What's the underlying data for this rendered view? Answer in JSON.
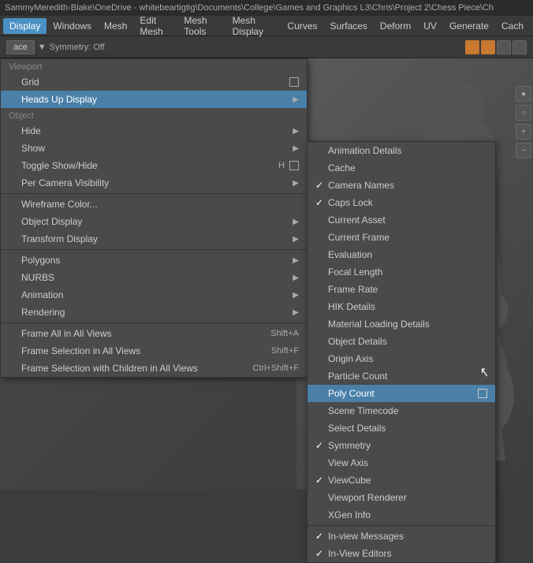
{
  "titleBar": {
    "text": "SammyMeredith-Blake\\OneDrive - whitebeartigtig\\Documents\\College\\Games and Graphics L3\\Chris\\Project 2\\Chess Piece\\Ch"
  },
  "menuBar": {
    "items": [
      {
        "label": "Display",
        "active": true
      },
      {
        "label": "Windows"
      },
      {
        "label": "Mesh"
      },
      {
        "label": "Edit Mesh"
      },
      {
        "label": "Mesh Tools"
      },
      {
        "label": "Mesh Display"
      },
      {
        "label": "Curves"
      },
      {
        "label": "Surfaces"
      },
      {
        "label": "Deform"
      },
      {
        "label": "UV"
      },
      {
        "label": "Generate"
      },
      {
        "label": "Cach"
      }
    ]
  },
  "toolbar": {
    "faceLabel": "ace",
    "symmetryLabel": "Symmetry: Off"
  },
  "primaryMenu": {
    "title": "Display",
    "sections": [
      {
        "label": "Viewport",
        "items": [
          {
            "label": "Grid",
            "check": false,
            "hasArrow": false,
            "hasBox": true,
            "shortcut": "",
            "highlighted": false
          },
          {
            "label": "Heads Up Display",
            "check": false,
            "hasArrow": true,
            "hasBox": false,
            "shortcut": "",
            "highlighted": true
          }
        ]
      },
      {
        "label": "Object",
        "items": [
          {
            "label": "Hide",
            "check": false,
            "hasArrow": true,
            "hasBox": false,
            "shortcut": "",
            "highlighted": false
          },
          {
            "label": "Show",
            "check": false,
            "hasArrow": true,
            "hasBox": false,
            "shortcut": "",
            "highlighted": false
          },
          {
            "label": "Toggle Show/Hide",
            "check": false,
            "hasArrow": false,
            "hasBox": true,
            "shortcut": "H",
            "highlighted": false
          },
          {
            "label": "Per Camera Visibility",
            "check": false,
            "hasArrow": true,
            "hasBox": false,
            "shortcut": "",
            "highlighted": false
          }
        ]
      },
      {
        "label": "",
        "items": [
          {
            "label": "Wireframe Color...",
            "check": false,
            "hasArrow": false,
            "hasBox": false,
            "shortcut": "",
            "highlighted": false
          },
          {
            "label": "Object Display",
            "check": false,
            "hasArrow": true,
            "hasBox": false,
            "shortcut": "",
            "highlighted": false
          },
          {
            "label": "Transform Display",
            "check": false,
            "hasArrow": true,
            "hasBox": false,
            "shortcut": "",
            "highlighted": false
          }
        ]
      },
      {
        "label": "",
        "items": [
          {
            "label": "Polygons",
            "check": false,
            "hasArrow": true,
            "hasBox": false,
            "shortcut": "",
            "highlighted": false
          },
          {
            "label": "NURBS",
            "check": false,
            "hasArrow": true,
            "hasBox": false,
            "shortcut": "",
            "highlighted": false
          },
          {
            "label": "Animation",
            "check": false,
            "hasArrow": true,
            "hasBox": false,
            "shortcut": "",
            "highlighted": false
          },
          {
            "label": "Rendering",
            "check": false,
            "hasArrow": true,
            "hasBox": false,
            "shortcut": "",
            "highlighted": false
          }
        ]
      },
      {
        "label": "",
        "items": [
          {
            "label": "Frame All in All Views",
            "check": false,
            "hasArrow": false,
            "hasBox": false,
            "shortcut": "Shift+A",
            "highlighted": false
          },
          {
            "label": "Frame Selection in All Views",
            "check": false,
            "hasArrow": false,
            "hasBox": false,
            "shortcut": "Shift+F",
            "highlighted": false
          },
          {
            "label": "Frame Selection with Children in All Views",
            "check": false,
            "hasArrow": false,
            "hasBox": false,
            "shortcut": "Ctrl+Shift+F",
            "highlighted": false
          }
        ]
      }
    ]
  },
  "secondaryMenu": {
    "items": [
      {
        "label": "Animation Details",
        "check": false,
        "highlighted": false
      },
      {
        "label": "Cache",
        "check": false,
        "highlighted": false
      },
      {
        "label": "Camera Names",
        "check": true,
        "highlighted": false
      },
      {
        "label": "Caps Lock",
        "check": true,
        "highlighted": false
      },
      {
        "label": "Current Asset",
        "check": false,
        "highlighted": false
      },
      {
        "label": "Current Frame",
        "check": false,
        "highlighted": false
      },
      {
        "label": "Evaluation",
        "check": false,
        "highlighted": false
      },
      {
        "label": "Focal Length",
        "check": false,
        "highlighted": false
      },
      {
        "label": "Frame Rate",
        "check": false,
        "highlighted": false
      },
      {
        "label": "HIK Details",
        "check": false,
        "highlighted": false
      },
      {
        "label": "Material Loading Details",
        "check": false,
        "highlighted": false
      },
      {
        "label": "Object Details",
        "check": false,
        "highlighted": false
      },
      {
        "label": "Origin Axis",
        "check": false,
        "highlighted": false
      },
      {
        "label": "Particle Count",
        "check": false,
        "highlighted": false
      },
      {
        "label": "Poly Count",
        "check": false,
        "highlighted": true,
        "hasBox": true
      },
      {
        "label": "Scene Timecode",
        "check": false,
        "highlighted": false
      },
      {
        "label": "Select Details",
        "check": false,
        "highlighted": false
      },
      {
        "label": "Symmetry",
        "check": true,
        "highlighted": false
      },
      {
        "label": "View Axis",
        "check": false,
        "highlighted": false
      },
      {
        "label": "ViewCube",
        "check": true,
        "highlighted": false
      },
      {
        "label": "Viewport Renderer",
        "check": false,
        "highlighted": false
      },
      {
        "label": "XGen Info",
        "check": false,
        "highlighted": false
      },
      {
        "label": "In-view Messages",
        "check": true,
        "highlighted": false
      },
      {
        "label": "In-View Editors",
        "check": true,
        "highlighted": false
      }
    ]
  },
  "icons": {
    "checkmark": "✓",
    "arrow": "▶",
    "cursor_char": "↖"
  }
}
